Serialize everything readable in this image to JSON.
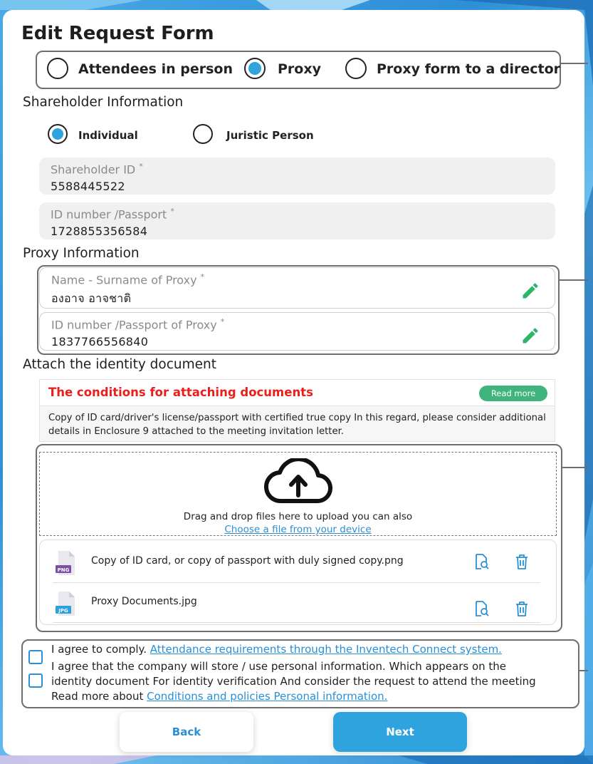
{
  "form": {
    "title": "Edit Request Form",
    "attendance_options": [
      "Attendees in person",
      "Proxy",
      "Proxy form to a director"
    ],
    "attendance_selected": "Proxy"
  },
  "shareholder": {
    "heading": "Shareholder Information",
    "type_options": [
      "Individual",
      "Juristic Person"
    ],
    "type_selected": "Individual",
    "shareholder_id_label": "Shareholder ID",
    "shareholder_id_value": "5588445522",
    "id_number_label": "ID number /Passport",
    "id_number_value": "1728855356584",
    "required_mark": "*"
  },
  "proxy": {
    "heading": "Proxy Information",
    "name_label": "Name - Surname of Proxy",
    "name_value": "องอาจ อาจชาติ",
    "id_label": "ID number /Passport of Proxy",
    "id_value": "1837766556840"
  },
  "attach": {
    "heading": "Attach the identity document",
    "conditions_title": "The conditions for attaching documents",
    "read_more": "Read more",
    "conditions_text": "Copy of ID card/driver's license/passport with certified true copy In this regard, please consider additional details in Enclosure 9 attached to the meeting invitation letter.",
    "drop_text": "Drag and drop files here to upload you can also",
    "choose_link": "Choose a file from your device",
    "files": [
      {
        "name": "Copy of ID card, or copy of passport with duly signed copy.png",
        "type": "PNG",
        "color": "#7b4fa3"
      },
      {
        "name": "Proxy Documents.jpg",
        "type": "JPG",
        "color": "#2aa0dd"
      }
    ]
  },
  "consent": {
    "line1_text": "I agree to comply. ",
    "line1_link": "Attendance requirements through the Inventech Connect system.",
    "line2a": "I agree that the company will store / use personal information. Which appears on the",
    "line2b": "identity document For identity verification And consider the request to attend the meeting",
    "line2c_text": "Read more about ",
    "line2c_link": "Conditions and policies Personal information."
  },
  "buttons": {
    "back": "Back",
    "next": "Next"
  },
  "colors": {
    "accent": "#2ea3dd",
    "link": "#2a8fd6",
    "pencil": "#2fb56a",
    "warning": "#e8201c",
    "read_more": "#3fb47c"
  }
}
